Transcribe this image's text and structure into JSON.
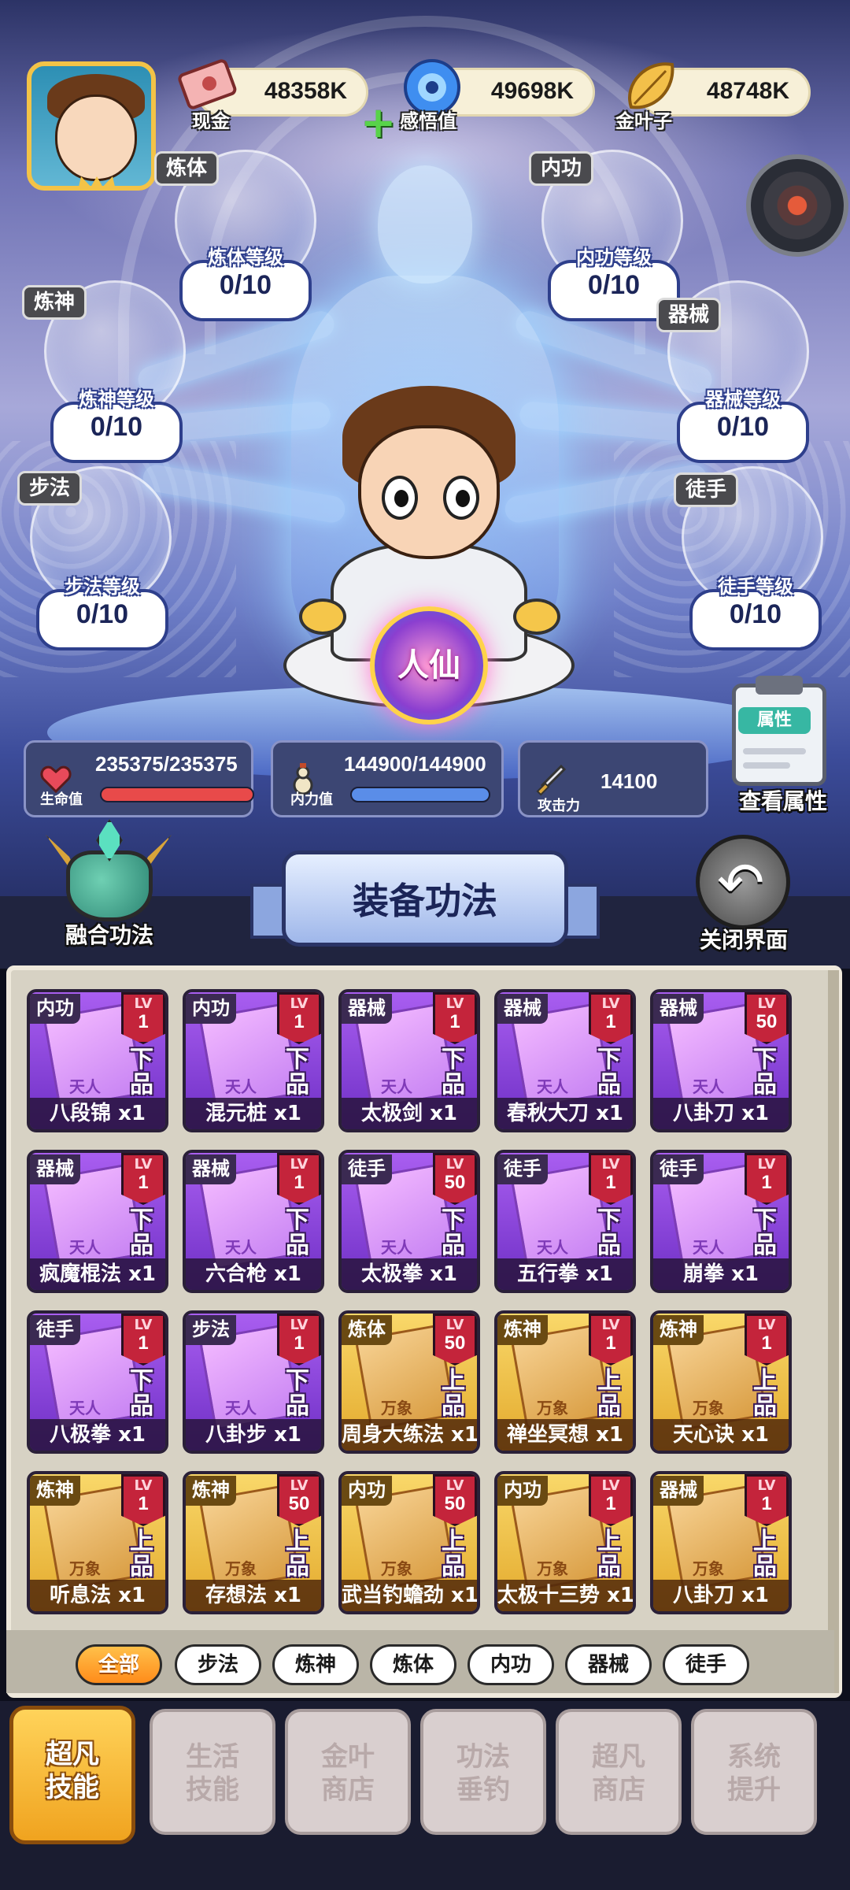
{
  "currency": [
    {
      "label": "现金",
      "value": "48358K",
      "icon": "cash-icon"
    },
    {
      "label": "感悟值",
      "value": "49698K",
      "icon": "insight-orb-icon"
    },
    {
      "label": "金叶子",
      "value": "48748K",
      "icon": "gold-leaf-icon"
    }
  ],
  "skills": {
    "lianti": {
      "tag": "炼体",
      "title": "炼体等级",
      "value": "0/10"
    },
    "neigong": {
      "tag": "内功",
      "title": "内功等级",
      "value": "0/10"
    },
    "lianshen": {
      "tag": "炼神",
      "title": "炼神等级",
      "value": "0/10"
    },
    "qixie": {
      "tag": "器械",
      "title": "器械等级",
      "value": "0/10"
    },
    "bufa": {
      "tag": "步法",
      "title": "步法等级",
      "value": "0/10"
    },
    "tushou": {
      "tag": "徒手",
      "title": "徒手等级",
      "value": "0/10"
    }
  },
  "realm_badge": "人仙",
  "stats": {
    "hp": {
      "label": "生命值",
      "value": "235375/235375",
      "fill": 1.0,
      "color": "#e84a4a"
    },
    "mp": {
      "label": "内力值",
      "value": "144900/144900",
      "fill": 1.0,
      "color": "#5a8de8"
    },
    "atk": {
      "label": "攻击力",
      "value": "14100"
    }
  },
  "buttons": {
    "view_attr": "查看属性",
    "attr_pill": "属性",
    "fuse": "融合功法",
    "close": "关闭界面"
  },
  "panel_title": "装备功法",
  "cards": [
    {
      "type": "内功",
      "lv": "1",
      "grade": "下品",
      "book": "天人",
      "name": "八段锦 x1",
      "tier": "purple"
    },
    {
      "type": "内功",
      "lv": "1",
      "grade": "下品",
      "book": "天人",
      "name": "混元桩 x1",
      "tier": "purple"
    },
    {
      "type": "器械",
      "lv": "1",
      "grade": "下品",
      "book": "天人",
      "name": "太极剑 x1",
      "tier": "purple"
    },
    {
      "type": "器械",
      "lv": "1",
      "grade": "下品",
      "book": "天人",
      "name": "春秋大刀 x1",
      "tier": "purple"
    },
    {
      "type": "器械",
      "lv": "50",
      "grade": "下品",
      "book": "天人",
      "name": "八卦刀 x1",
      "tier": "purple"
    },
    {
      "type": "器械",
      "lv": "1",
      "grade": "下品",
      "book": "天人",
      "name": "疯魔棍法 x1",
      "tier": "purple"
    },
    {
      "type": "器械",
      "lv": "1",
      "grade": "下品",
      "book": "天人",
      "name": "六合枪 x1",
      "tier": "purple"
    },
    {
      "type": "徒手",
      "lv": "50",
      "grade": "下品",
      "book": "天人",
      "name": "太极拳 x1",
      "tier": "purple"
    },
    {
      "type": "徒手",
      "lv": "1",
      "grade": "下品",
      "book": "天人",
      "name": "五行拳 x1",
      "tier": "purple"
    },
    {
      "type": "徒手",
      "lv": "1",
      "grade": "下品",
      "book": "天人",
      "name": "崩拳 x1",
      "tier": "purple"
    },
    {
      "type": "徒手",
      "lv": "1",
      "grade": "下品",
      "book": "天人",
      "name": "八极拳 x1",
      "tier": "purple"
    },
    {
      "type": "步法",
      "lv": "1",
      "grade": "下品",
      "book": "天人",
      "name": "八卦步 x1",
      "tier": "purple"
    },
    {
      "type": "炼体",
      "lv": "50",
      "grade": "上品",
      "book": "万象",
      "name": "周身大练法 x1",
      "tier": "gold"
    },
    {
      "type": "炼神",
      "lv": "1",
      "grade": "上品",
      "book": "万象",
      "name": "禅坐冥想 x1",
      "tier": "gold"
    },
    {
      "type": "炼神",
      "lv": "1",
      "grade": "上品",
      "book": "万象",
      "name": "天心诀 x1",
      "tier": "gold"
    },
    {
      "type": "炼神",
      "lv": "1",
      "grade": "上品",
      "book": "万象",
      "name": "听息法 x1",
      "tier": "gold"
    },
    {
      "type": "炼神",
      "lv": "50",
      "grade": "上品",
      "book": "万象",
      "name": "存想法 x1",
      "tier": "gold"
    },
    {
      "type": "内功",
      "lv": "50",
      "grade": "上品",
      "book": "万象",
      "name": "武当钓蟾劲 x1",
      "tier": "gold"
    },
    {
      "type": "内功",
      "lv": "1",
      "grade": "上品",
      "book": "万象",
      "name": "太极十三势 x1",
      "tier": "gold"
    },
    {
      "type": "器械",
      "lv": "1",
      "grade": "上品",
      "book": "万象",
      "name": "八卦刀 x1",
      "tier": "gold"
    }
  ],
  "filters": [
    "全部",
    "步法",
    "炼神",
    "炼体",
    "内功",
    "器械",
    "徒手"
  ],
  "active_filter": 0,
  "tabs": [
    {
      "line1": "超凡",
      "line2": "技能"
    },
    {
      "line1": "生活",
      "line2": "技能"
    },
    {
      "line1": "金叶",
      "line2": "商店"
    },
    {
      "line1": "功法",
      "line2": "垂钓"
    },
    {
      "line1": "超凡",
      "line2": "商店"
    },
    {
      "line1": "系统",
      "line2": "提升"
    }
  ],
  "active_tab": 0,
  "card_lv_label": "LV"
}
